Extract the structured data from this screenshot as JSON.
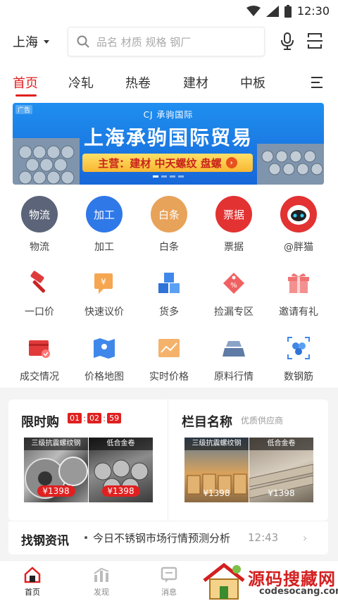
{
  "status": {
    "time": "12:30"
  },
  "header": {
    "city": "上海",
    "search_placeholder": "品名 材质 规格 钢厂"
  },
  "tabs": [
    "首页",
    "冷轧",
    "热卷",
    "建材",
    "中板"
  ],
  "banner": {
    "ad": "广告",
    "logo": "CJ 承驹国际",
    "title": "上海承驹国际贸易",
    "subtitle": "主营：建材 中天螺纹 盘螺"
  },
  "grid_row1": [
    {
      "badge": "物流",
      "label": "物流",
      "color": "#5b6478"
    },
    {
      "badge": "加工",
      "label": "加工",
      "color": "#2f78e8"
    },
    {
      "badge": "白条",
      "label": "白条",
      "color": "#e8a35a"
    },
    {
      "badge": "票据",
      "label": "票据",
      "color": "#e33232"
    },
    {
      "badge": "",
      "label": "@胖猫",
      "color": "#e33232"
    }
  ],
  "grid_row2": [
    "一口价",
    "快速议价",
    "货多",
    "捡漏专区",
    "邀请有礼"
  ],
  "grid_row3": [
    "成交情况",
    "价格地图",
    "实时价格",
    "原料行情",
    "数钢筋"
  ],
  "flash": {
    "title": "限时购",
    "h": "01",
    "m": "02",
    "s": "59"
  },
  "column": {
    "title": "栏目名称",
    "subtitle": "优质供应商"
  },
  "products": [
    {
      "tag": "三级抗震螺纹钢",
      "price": "¥1398"
    },
    {
      "tag": "低合金卷",
      "price": "¥1398"
    },
    {
      "tag": "三级抗震螺纹钢",
      "price": "¥1398"
    },
    {
      "tag": "低合金卷",
      "price": "¥1398"
    }
  ],
  "news": {
    "title": "找钢资讯",
    "text": "今日不锈钢市场行情预测分析",
    "time": "12:43"
  },
  "bottom_tabs": [
    "首页",
    "发现",
    "消息"
  ],
  "watermark": {
    "text": "源码搜藏网",
    "url": "codesocang.com"
  },
  "colors": {
    "accent": "#e02020",
    "banner": "#1f7fea"
  }
}
